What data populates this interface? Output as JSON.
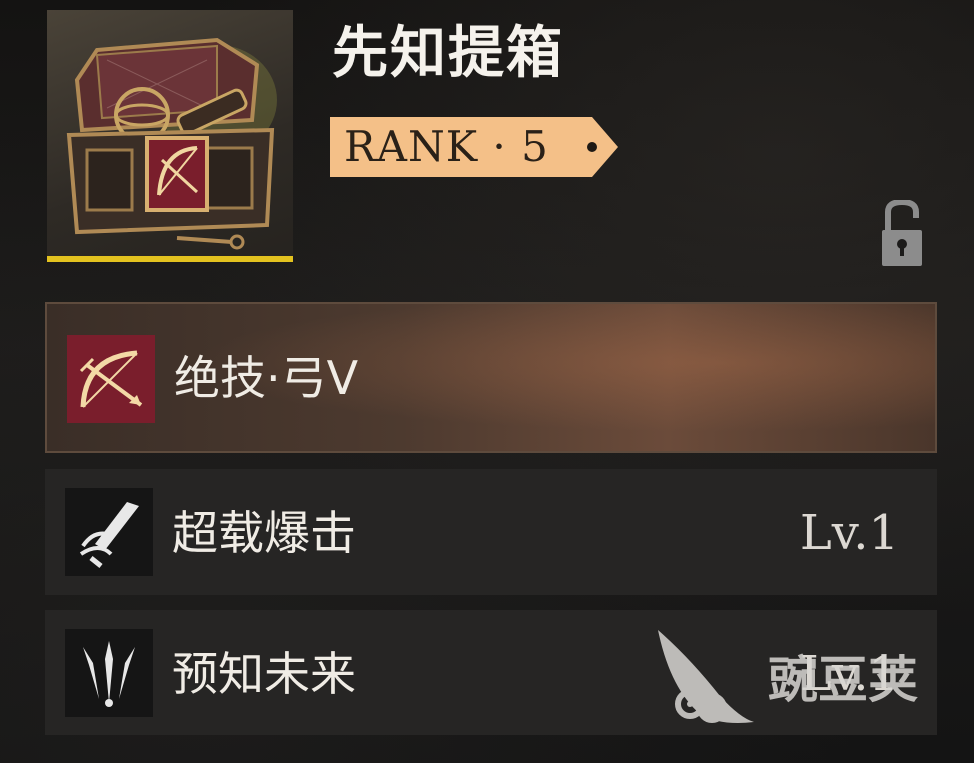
{
  "item": {
    "name": "先知提箱",
    "rarity_color": "#e3c21f",
    "icon": "treasure-chest-bow-icon"
  },
  "rank": {
    "label": "RANK · 5",
    "badge_color": "#f4c088"
  },
  "lock": {
    "icon": "lock-open-icon",
    "state": "unlocked"
  },
  "skills": [
    {
      "name": "绝技·弓V",
      "icon": "bow-arrow-icon",
      "level": "",
      "highlighted": true
    },
    {
      "name": "超载爆击",
      "icon": "sword-strike-icon",
      "level": "Lv.1",
      "highlighted": false
    },
    {
      "name": "预知未来",
      "icon": "trident-icon",
      "level": "Lv.1",
      "highlighted": false
    }
  ],
  "watermark": {
    "text": "豌豆荚",
    "icon": "pea-pod-logo-icon"
  }
}
